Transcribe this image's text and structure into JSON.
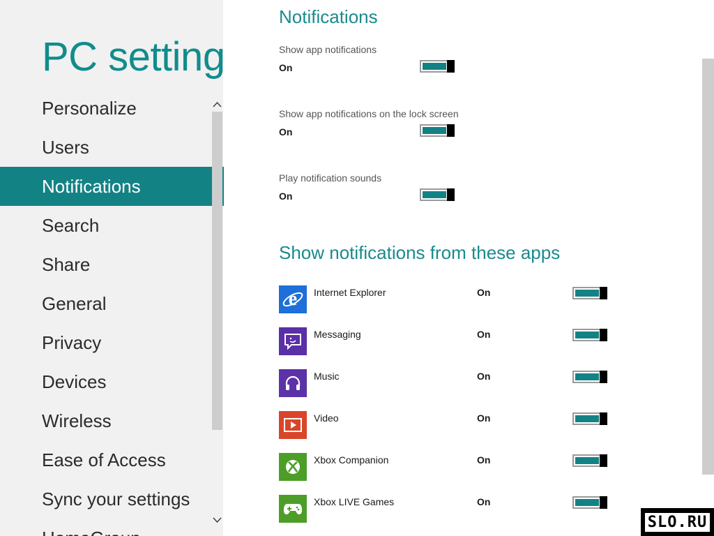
{
  "app_title": "PC settings",
  "nav": {
    "items": [
      {
        "label": "Personalize",
        "selected": false
      },
      {
        "label": "Users",
        "selected": false
      },
      {
        "label": "Notifications",
        "selected": true
      },
      {
        "label": "Search",
        "selected": false
      },
      {
        "label": "Share",
        "selected": false
      },
      {
        "label": "General",
        "selected": false
      },
      {
        "label": "Privacy",
        "selected": false
      },
      {
        "label": "Devices",
        "selected": false
      },
      {
        "label": "Wireless",
        "selected": false
      },
      {
        "label": "Ease of Access",
        "selected": false
      },
      {
        "label": "Sync your settings",
        "selected": false
      },
      {
        "label": "HomeGroup",
        "selected": false
      }
    ],
    "scroll_up_icon": "chevron-up-icon",
    "scroll_down_icon": "chevron-down-icon"
  },
  "notifications": {
    "heading": "Notifications",
    "settings": [
      {
        "label": "Show app notifications",
        "state": "On",
        "on": true
      },
      {
        "label": "Show app notifications on the lock screen",
        "state": "On",
        "on": true
      },
      {
        "label": "Play notification sounds",
        "state": "On",
        "on": true
      }
    ]
  },
  "apps_section": {
    "heading": "Show notifications from these apps",
    "apps": [
      {
        "name": "Internet Explorer",
        "state": "On",
        "on": true,
        "icon": "internet-explorer-icon",
        "tile_color": "#1e6fd9"
      },
      {
        "name": "Messaging",
        "state": "On",
        "on": true,
        "icon": "messaging-icon",
        "tile_color": "#5a2fa8"
      },
      {
        "name": "Music",
        "state": "On",
        "on": true,
        "icon": "music-icon",
        "tile_color": "#5b32a8"
      },
      {
        "name": "Video",
        "state": "On",
        "on": true,
        "icon": "video-icon",
        "tile_color": "#d9452a"
      },
      {
        "name": "Xbox Companion",
        "state": "On",
        "on": true,
        "icon": "xbox-icon",
        "tile_color": "#4c9e28"
      },
      {
        "name": "Xbox LIVE Games",
        "state": "On",
        "on": true,
        "icon": "game-controller-icon",
        "tile_color": "#4c9e28"
      }
    ]
  },
  "watermark": "SLO.RU",
  "colors": {
    "accent": "#138285",
    "heading": "#1b8a8c",
    "left_pane": "#f1f1f1"
  }
}
